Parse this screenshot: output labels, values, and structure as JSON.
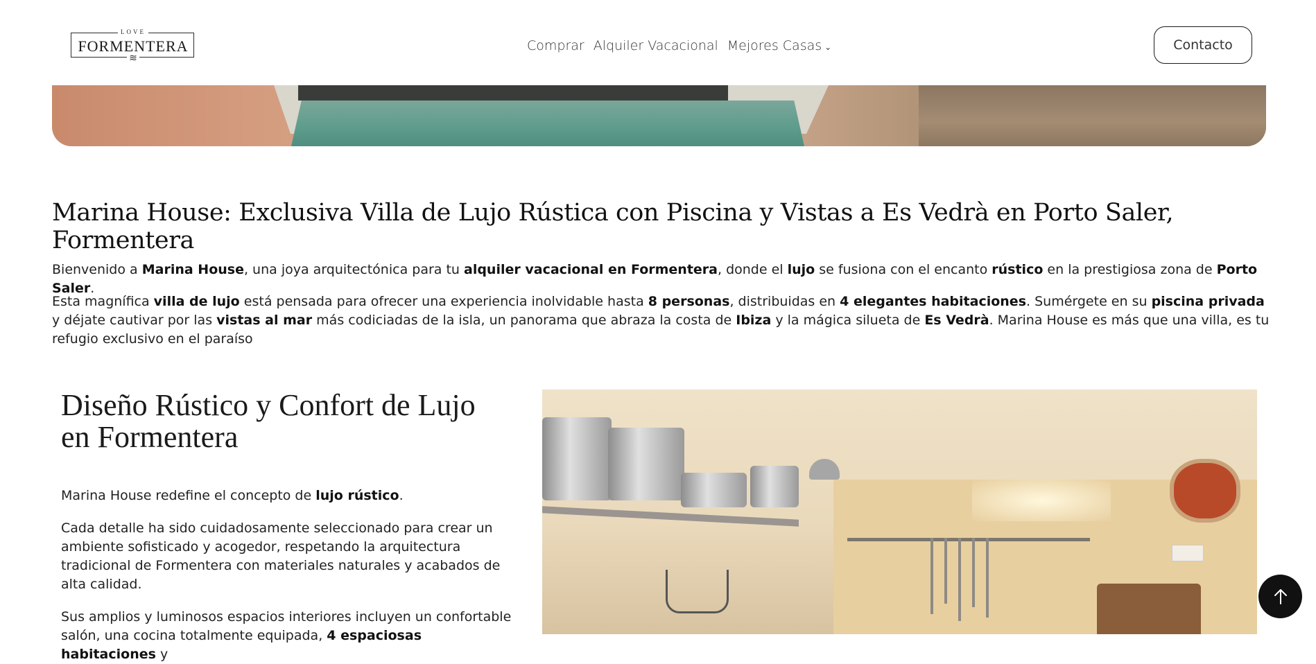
{
  "header": {
    "logo": {
      "top": "LOVE",
      "name": "FORMENTERA",
      "waves": "≋"
    },
    "nav": [
      {
        "label": "Comprar"
      },
      {
        "label": "Alquiler Vacacional"
      },
      {
        "label": "Mejores Casas",
        "has_dropdown": true
      }
    ],
    "contact_label": "Contacto"
  },
  "main": {
    "title": "Marina House: Exclusiva Villa de Lujo Rústica con Piscina y Vistas a Es Vedrà en Porto Saler, Formentera",
    "intro_1": [
      {
        "t": "Bienvenido a "
      },
      {
        "t": "Marina House",
        "b": true
      },
      {
        "t": ", una joya arquitectónica para tu "
      },
      {
        "t": "alquiler vacacional en Formentera",
        "b": true
      },
      {
        "t": ", donde el "
      },
      {
        "t": "lujo",
        "b": true
      },
      {
        "t": " se fusiona con el encanto "
      },
      {
        "t": "rústico",
        "b": true
      },
      {
        "t": " en la prestigiosa zona de "
      },
      {
        "t": "Porto Saler",
        "b": true
      },
      {
        "t": "."
      }
    ],
    "intro_2": [
      {
        "t": "Esta magnífica "
      },
      {
        "t": "villa de lujo",
        "b": true
      },
      {
        "t": " está pensada para ofrecer una experiencia inolvidable hasta "
      },
      {
        "t": "8 personas",
        "b": true
      },
      {
        "t": ", distribuidas en "
      },
      {
        "t": "4 elegantes habitaciones",
        "b": true
      },
      {
        "t": ". Sumérgete en su "
      },
      {
        "t": "piscina privada",
        "b": true
      },
      {
        "t": " y déjate cautivar por las "
      },
      {
        "t": "vistas al mar",
        "b": true
      },
      {
        "t": " más codiciadas de la isla, un panorama que abraza la costa de "
      },
      {
        "t": "Ibiza",
        "b": true
      },
      {
        "t": " y la mágica silueta de "
      },
      {
        "t": "Es Vedrà",
        "b": true
      },
      {
        "t": ". Marina House es más que una villa, es tu refugio exclusivo en el paraíso"
      }
    ],
    "section": {
      "title": "Diseño Rústico y Confort de Lujo en Formentera",
      "p1": [
        {
          "t": "Marina House redefine el concepto de "
        },
        {
          "t": "lujo rústico",
          "b": true
        },
        {
          "t": "."
        }
      ],
      "p2": [
        {
          "t": "Cada detalle ha sido cuidadosamente seleccionado para crear un ambiente sofisticado y acogedor, respetando la arquitectura tradicional de Formentera con materiales naturales y acabados de alta calidad."
        }
      ],
      "p3": [
        {
          "t": "Sus amplios y luminosos espacios interiores incluyen un confortable salón, una cocina totalmente equipada, "
        },
        {
          "t": "4 espaciosas habitaciones",
          "b": true
        },
        {
          "t": " y"
        }
      ]
    }
  },
  "back_to_top_icon": "arrow-up-icon"
}
